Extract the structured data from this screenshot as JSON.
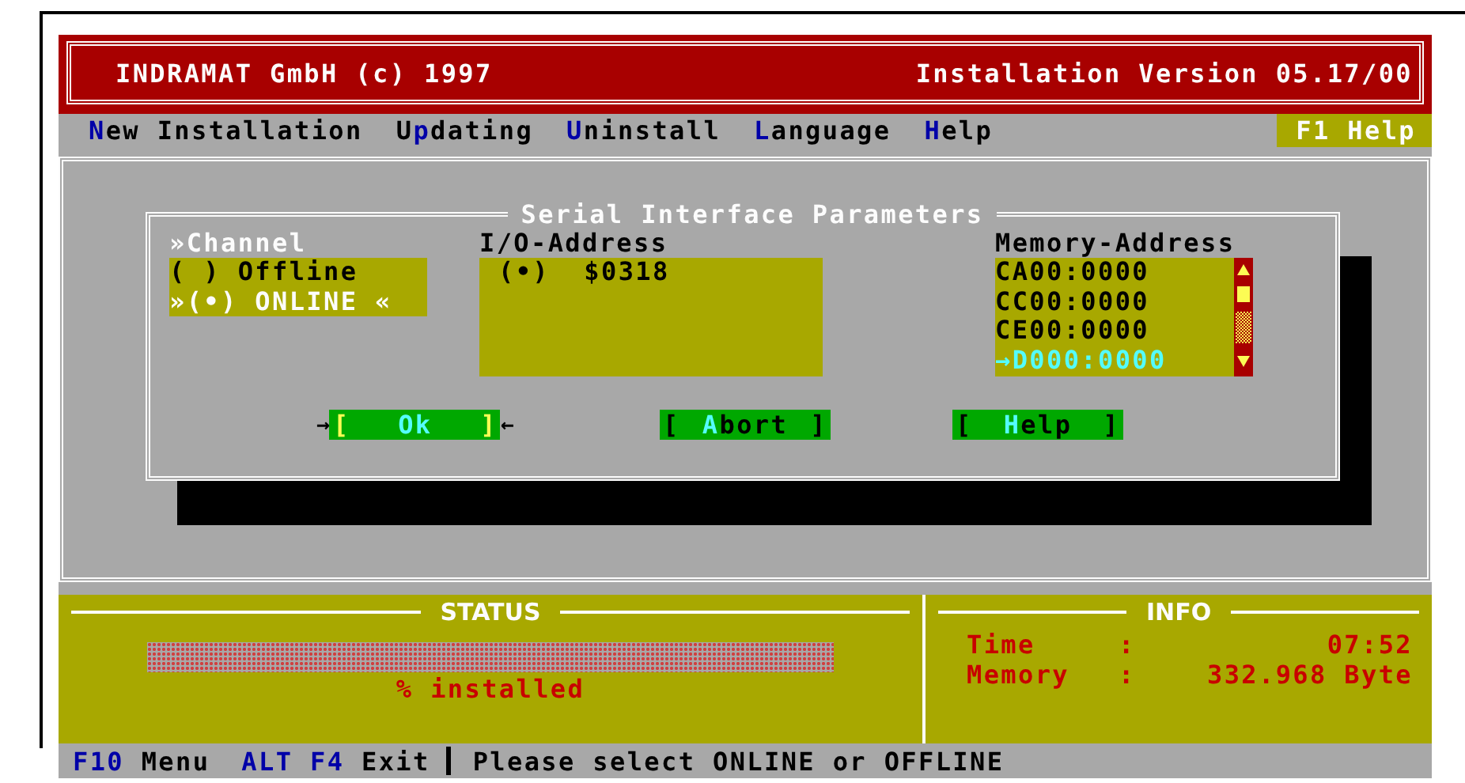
{
  "header": {
    "company": "INDRAMAT GmbH (c) 1997",
    "version": "Installation Version 05.17/00"
  },
  "menu": [
    {
      "key": "N",
      "post": "ew Installation"
    },
    {
      "pre": "U",
      "key": "p",
      "post": "dating"
    },
    {
      "key": "U",
      "post": "ninstall"
    },
    {
      "key": "L",
      "post": "anguage"
    },
    {
      "key": "H",
      "post": "elp"
    }
  ],
  "f1_help": "F1 Help",
  "dialog": {
    "title": "Serial Interface Parameters",
    "channel": {
      "label": "»Channel",
      "options": [
        {
          "text": "( ) Offline",
          "selected": false
        },
        {
          "text": "»(•) ONLINE «",
          "selected": true
        }
      ]
    },
    "io": {
      "label": "I/O-Address",
      "options": [
        "(•)  $0318"
      ]
    },
    "memory": {
      "label": "Memory-Address",
      "items": [
        {
          "text": "CA00:0000",
          "selected": false
        },
        {
          "text": "CC00:0000",
          "selected": false
        },
        {
          "text": "CE00:0000",
          "selected": false
        },
        {
          "text": "→D000:0000",
          "selected": true
        }
      ]
    },
    "buttons": [
      {
        "open": "[",
        "key": "Ok",
        "close": "]",
        "focused": true,
        "left_mark": "→",
        "right_mark": "←"
      },
      {
        "open": "[",
        "key": "A",
        "post": "bort",
        "close": "]",
        "focused": false
      },
      {
        "open": "[",
        "key": "H",
        "post": "elp",
        "close": "]",
        "focused": false
      }
    ]
  },
  "status": {
    "title": "STATUS",
    "progress": {
      "level": 0
    },
    "caption": "% installed"
  },
  "info": {
    "title": "INFO",
    "rows": [
      {
        "label": "Time",
        "sep": ":",
        "value": "07:52"
      },
      {
        "label": "Memory",
        "sep": ":",
        "value": "332.968 Byte"
      }
    ]
  },
  "bottom": {
    "keys": [
      {
        "key": "F10",
        "label": "Menu"
      },
      {
        "key": "ALT F4",
        "label": "Exit"
      }
    ],
    "message": "Please select ONLINE or OFFLINE"
  }
}
